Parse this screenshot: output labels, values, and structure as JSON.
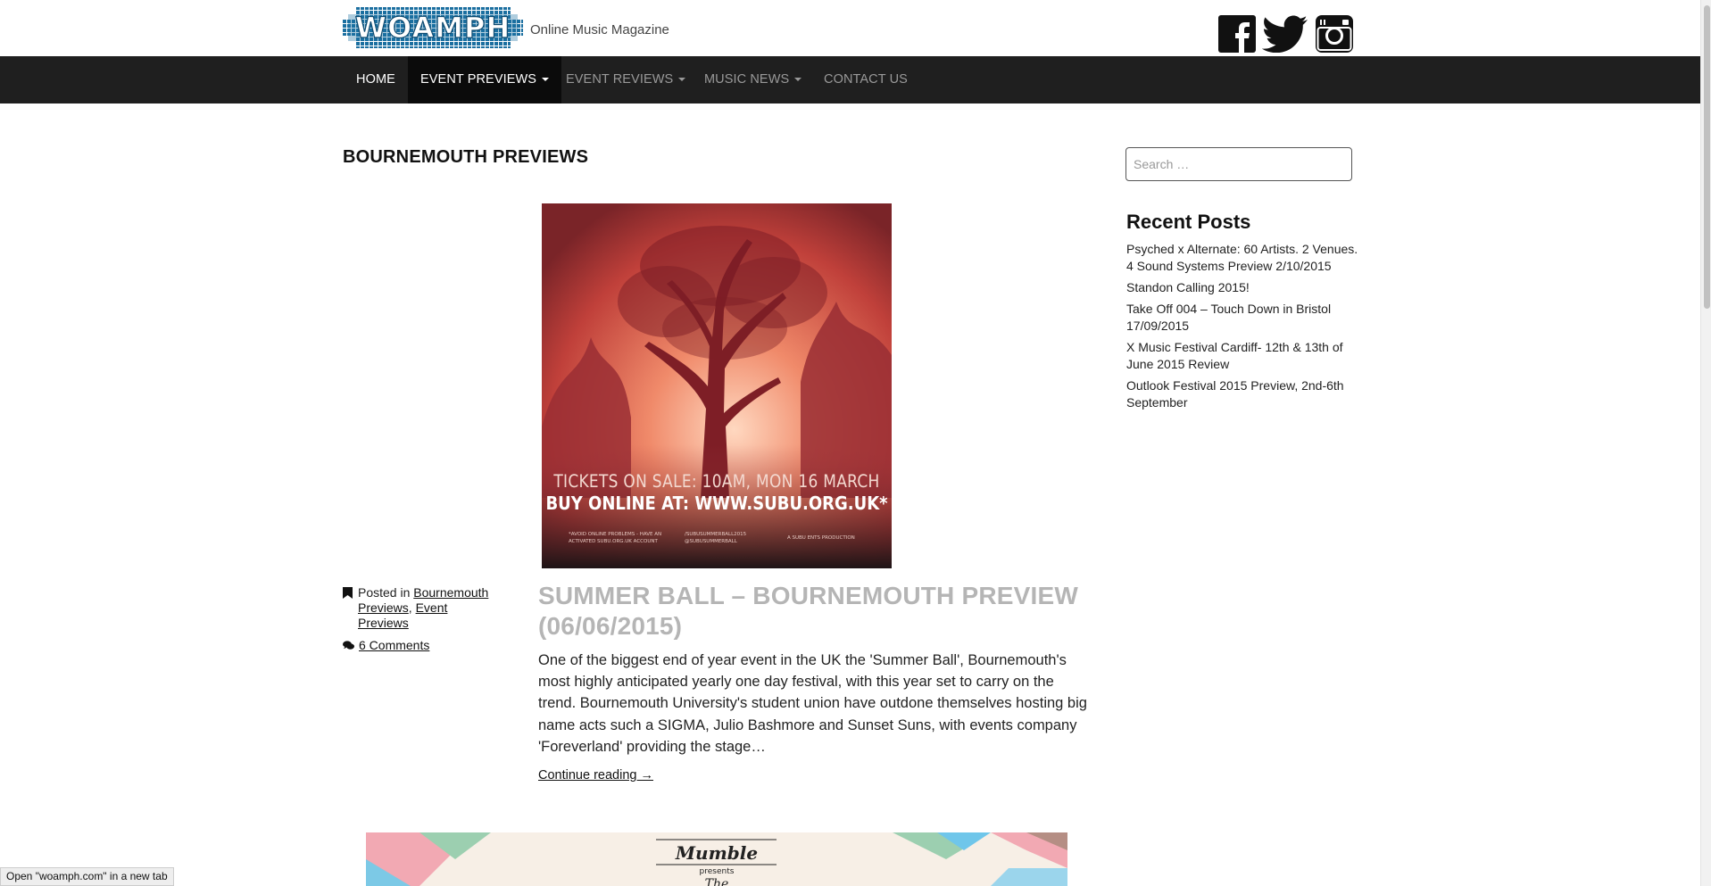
{
  "header": {
    "logo_text": "WOAMPH",
    "tagline": "Online Music Magazine"
  },
  "social": {
    "facebook_icon": "facebook-icon",
    "twitter_icon": "twitter-icon",
    "instagram_icon": "instagram-icon"
  },
  "nav": {
    "home": "HOME",
    "event_previews": "EVENT PREVIEWS",
    "event_reviews": "EVENT REVIEWS",
    "music_news": "MUSIC NEWS",
    "contact": "CONTACT US"
  },
  "main": {
    "page_title": "BOURNEMOUTH PREVIEWS",
    "post": {
      "image": {
        "line1": "TICKETS ON SALE: 10AM, MON 16 MARCH",
        "line2": "BUY ONLINE AT: WWW.SUBU.ORG.UK*",
        "fine_left1": "*AVOID ONLINE PROBLEMS - HAVE AN",
        "fine_left2": "ACTIVATED SUBU.ORG.UK ACCOUNT",
        "fine_mid1": "/SUBUSUMMERBALL2015",
        "fine_mid2": "@SUBUSUMMERBALL",
        "fine_right": "A SUBU ENTS PRODUCTION"
      },
      "meta_posted_in": "Posted in",
      "category1": "Bournemouth Previews",
      "separator": ",",
      "category2": "Event Previews",
      "comments": "6 Comments",
      "title": "SUMMER BALL – BOURNEMOUTH PREVIEW (06/06/2015)",
      "excerpt": "One of the biggest end of year event in the UK the 'Summer Ball', Bournemouth's most highly anticipated yearly one day festival, with this year set to carry on the trend. Bournemouth University's student union have outdone themselves hosting big name acts such a SIGMA, Julio Bashmore and Sunset Suns, with events company 'Foreverland' providing the stage…",
      "continue_reading": "Continue reading →"
    },
    "next_post_image": {
      "brand": "Mumble",
      "presents": "presents",
      "partial": "The"
    }
  },
  "sidebar": {
    "search_placeholder": "Search …",
    "recent_title": "Recent Posts",
    "recent_posts": [
      "Psyched x Alternate: 60 Artists. 2 Venues. 4 Sound Systems Preview 2/10/2015",
      "Standon Calling 2015!",
      "Take Off 004 – Touch Down in Bristol 17/09/2015",
      "X Music Festival Cardiff- 12th & 13th of June 2015 Review",
      "Outlook Festival 2015 Preview, 2nd-6th September"
    ]
  },
  "statusbar": {
    "text": "Open \"woamph.com\" in a new tab"
  },
  "colors": {
    "navbar_bg": "#1f1f1f",
    "nav_active_bg": "#0b0b0b",
    "logo_blue": "#1b6fa0",
    "post_title": "#b5b5b5"
  }
}
